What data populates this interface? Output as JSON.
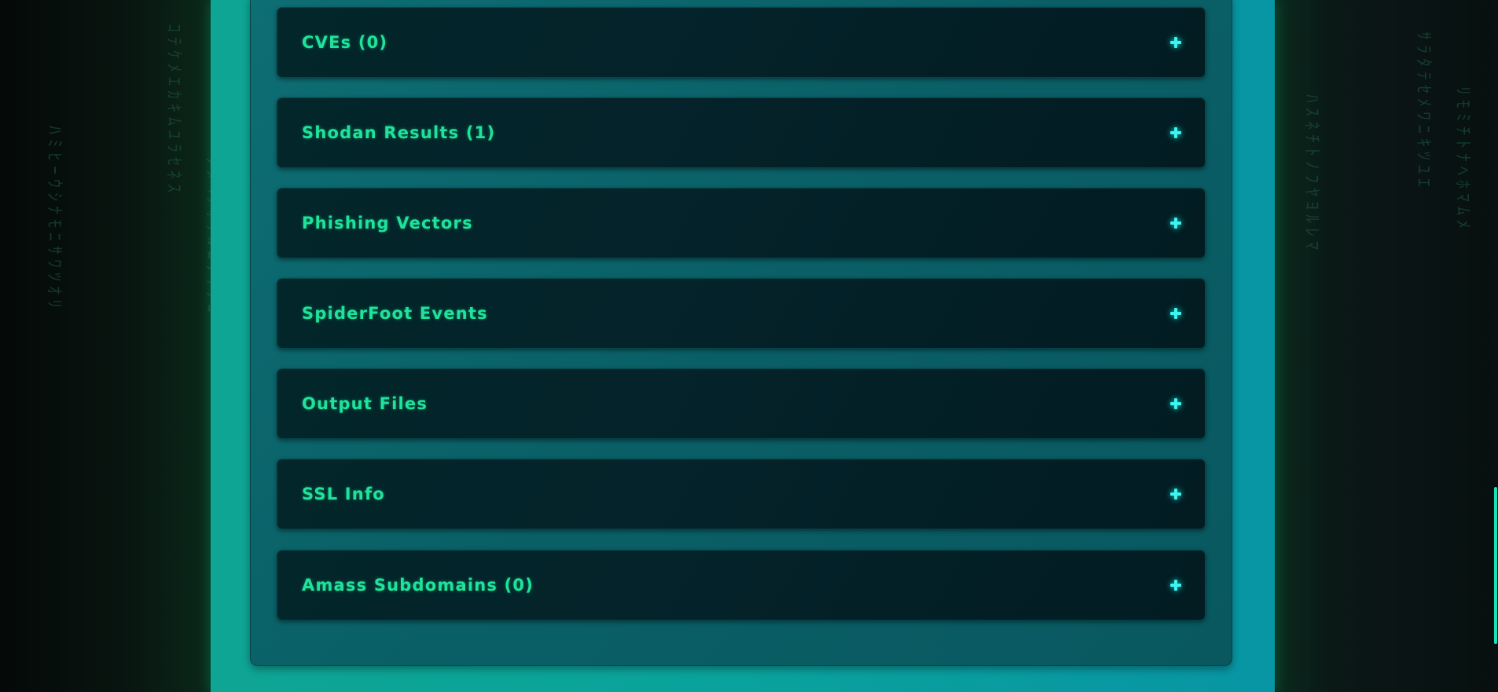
{
  "sections": [
    {
      "title": "CVEs (0)",
      "icon": "plus-icon"
    },
    {
      "title": "Shodan Results (1)",
      "icon": "plus-icon"
    },
    {
      "title": "Phishing Vectors",
      "icon": "plus-icon"
    },
    {
      "title": "SpiderFoot Events",
      "icon": "plus-icon"
    },
    {
      "title": "Output Files",
      "icon": "plus-icon"
    },
    {
      "title": "SSL Info",
      "icon": "plus-icon"
    },
    {
      "title": "Amass Subdomains (0)",
      "icon": "plus-icon"
    }
  ],
  "colors": {
    "accent_text": "#1fe39a",
    "icon": "#3ff3ef",
    "frame": "#0aa39b",
    "panel": "#0a5f66",
    "section": "#022629",
    "scrollbar_thumb": "#18e0b8"
  }
}
